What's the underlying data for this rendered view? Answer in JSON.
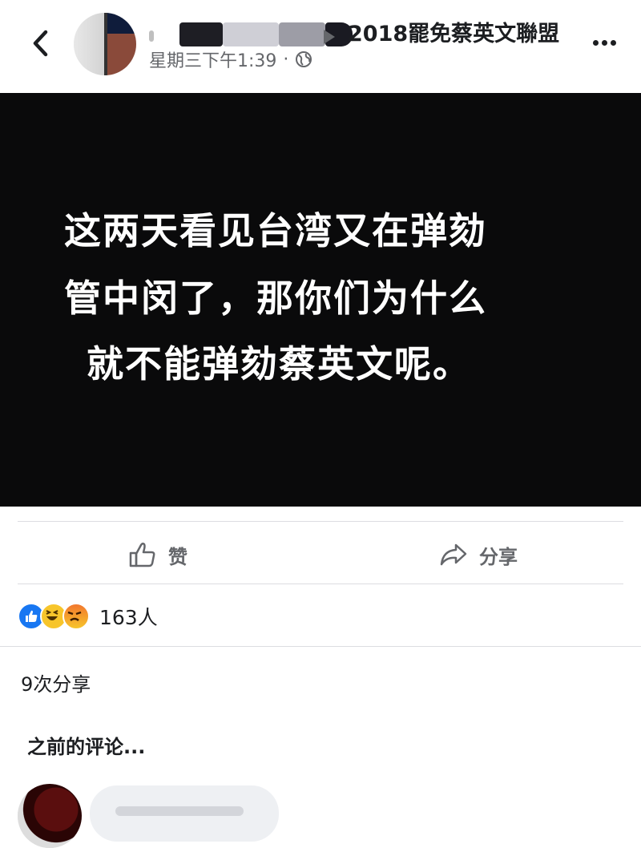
{
  "header": {
    "page_name": "2018罷免蔡英文聯盟",
    "timestamp": "星期三下午1:39",
    "separator": "·",
    "privacy_icon": "globe-icon",
    "back_icon": "chevron-left-icon",
    "more_icon": "more-horizontal-icon"
  },
  "post": {
    "lines": [
      "这两天看见台湾又在弹劾",
      "管中闵了，那你们为什么",
      "就不能弹劾蔡英文呢。"
    ],
    "background_color": "#0a0a0b",
    "text_color": "#ffffff"
  },
  "actions": {
    "like_label": "赞",
    "share_label": "分享"
  },
  "reactions": {
    "types": [
      "like",
      "haha",
      "angry"
    ],
    "count": "163人"
  },
  "shares": {
    "label": "9次分享"
  },
  "comments": {
    "previous_label": "之前的评论..."
  },
  "colors": {
    "accent": "#1877f2",
    "secondary_text": "#65676b",
    "divider": "#dcdde1"
  }
}
